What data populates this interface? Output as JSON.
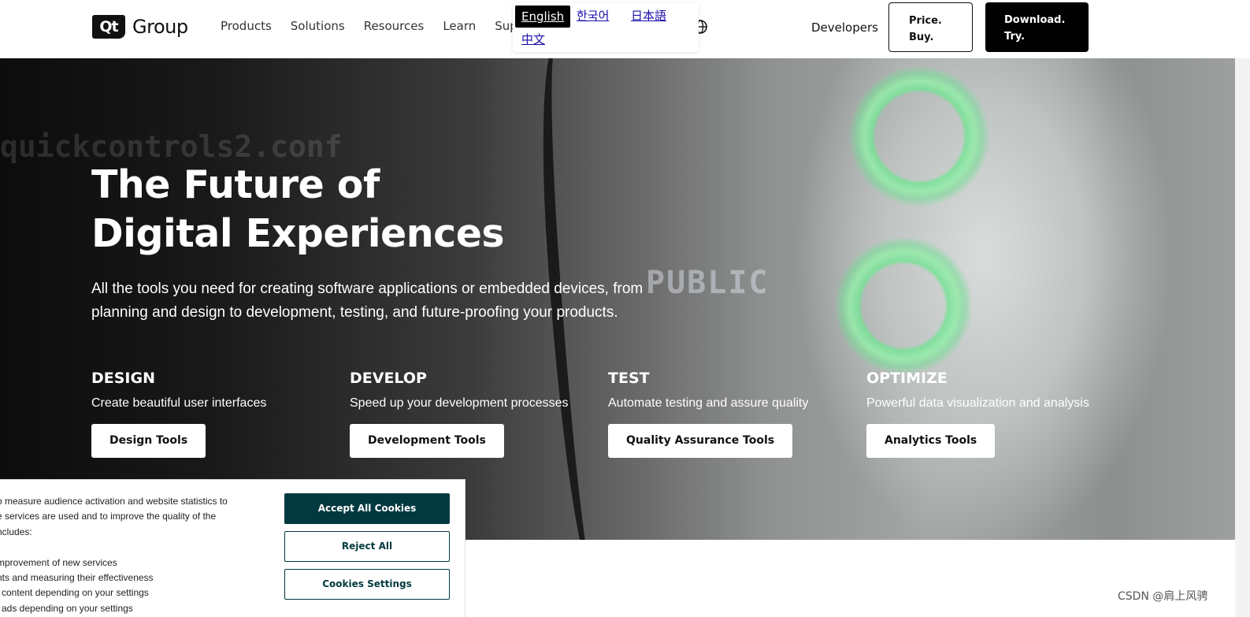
{
  "header": {
    "logo_mark": "Qt",
    "logo_text": "Group",
    "nav": [
      "Products",
      "Solutions",
      "Resources",
      "Learn",
      "Suppor"
    ],
    "languages": {
      "current": "English",
      "others": [
        "한국어",
        "日本語",
        "中文"
      ]
    },
    "globe_icon": "globe-icon",
    "developers": "Developers",
    "price_line1": "Price.",
    "price_line2": "Buy.",
    "download_line1": "Download.",
    "download_line2": "Try."
  },
  "hero": {
    "title_line1": "The Future of",
    "title_line2": "Digital Experiences",
    "subtitle_line1": "All the tools you need for creating software applications or embedded devices, from",
    "subtitle_line2": "planning and design to development, testing, and future-proofing your products.",
    "bg_text": "quickcontrols2.conf",
    "bg_public": "PUBLIC",
    "columns": [
      {
        "heading": "DESIGN",
        "desc": "Create beautiful user interfaces",
        "button": "Design Tools"
      },
      {
        "heading": "DEVELOP",
        "desc": "Speed up your development processes",
        "button": "Development Tools"
      },
      {
        "heading": "TEST",
        "desc": "Automate testing and assure quality",
        "button": "Quality Assurance Tools"
      },
      {
        "heading": "OPTIMIZE",
        "desc": "Powerful data visualization and analysis",
        "button": "Analytics Tools"
      }
    ]
  },
  "cookie": {
    "lines": [
      "o measure audience activation and website statistics to",
      "e services are used and to improve the quality of the",
      "ncludes:",
      "",
      "mprovement of new services",
      "nts and measuring their effectiveness",
      "l content depending on your settings",
      "l ads depending on your settings"
    ],
    "accept": "Accept All Cookies",
    "reject": "Reject All",
    "settings": "Cookies Settings"
  },
  "watermark": "CSDN @肩上风骋",
  "colors": {
    "cookie_accent": "#02393f",
    "brand_black": "#000000"
  }
}
